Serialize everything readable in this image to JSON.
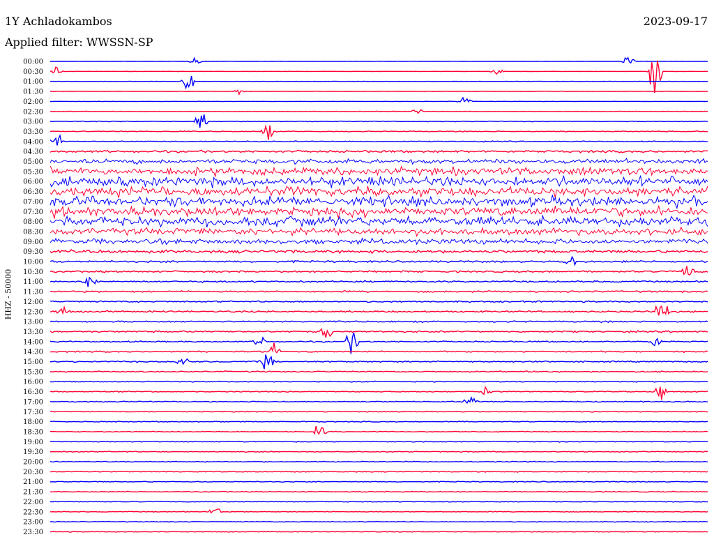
{
  "header": {
    "station": "1Y Achladokambos",
    "date": "2023-09-17",
    "filter_label": "Applied filter: WWSSN-SP"
  },
  "channel_label": "HHZ - 50000",
  "colors": {
    "even_trace": "#0000ff",
    "odd_trace": "#ff0033"
  },
  "chart_data": {
    "type": "line",
    "title": "1Y Achladokambos",
    "subtitle": "Applied filter: WWSSN-SP",
    "ylabel": "HHZ - 50000",
    "rows": [
      "00:00",
      "00:30",
      "01:00",
      "01:30",
      "02:00",
      "02:30",
      "03:00",
      "03:30",
      "04:00",
      "04:30",
      "05:00",
      "05:30",
      "06:00",
      "06:30",
      "07:00",
      "07:30",
      "08:00",
      "08:30",
      "09:00",
      "09:30",
      "10:00",
      "10:30",
      "11:00",
      "11:30",
      "12:00",
      "12:30",
      "13:00",
      "13:30",
      "14:00",
      "14:30",
      "15:00",
      "15:30",
      "16:00",
      "16:30",
      "17:00",
      "17:30",
      "18:00",
      "18:30",
      "19:00",
      "19:30",
      "20:00",
      "20:30",
      "21:00",
      "21:30",
      "22:00",
      "22:30",
      "23:00",
      "23:30"
    ],
    "activity": [
      0.15,
      0.2,
      0.2,
      0.3,
      0.2,
      0.3,
      0.5,
      0.6,
      0.7,
      1.5,
      3.5,
      6,
      7,
      7,
      7,
      7,
      7,
      5,
      4,
      2,
      1.3,
      1.2,
      1.1,
      1.1,
      1.0,
      1.1,
      1.0,
      1.1,
      0.9,
      0.9,
      0.9,
      0.8,
      0.7,
      0.7,
      0.7,
      0.6,
      0.6,
      0.6,
      0.6,
      0.6,
      0.6,
      0.6,
      0.6,
      0.6,
      0.5,
      0.5,
      0.5,
      0.5
    ],
    "events": [
      {
        "row": 0,
        "t": 0.22,
        "amp": 5
      },
      {
        "row": 0,
        "t": 0.88,
        "amp": 8
      },
      {
        "row": 1,
        "t": 0.01,
        "amp": 8
      },
      {
        "row": 1,
        "t": 0.68,
        "amp": 6
      },
      {
        "row": 1,
        "t": 0.92,
        "amp": 40
      },
      {
        "row": 2,
        "t": 0.21,
        "amp": 18
      },
      {
        "row": 3,
        "t": 0.29,
        "amp": 6
      },
      {
        "row": 4,
        "t": 0.63,
        "amp": 8
      },
      {
        "row": 5,
        "t": 0.56,
        "amp": 6
      },
      {
        "row": 6,
        "t": 0.23,
        "amp": 14
      },
      {
        "row": 7,
        "t": 0.33,
        "amp": 16
      },
      {
        "row": 8,
        "t": 0.01,
        "amp": 14
      },
      {
        "row": 20,
        "t": 0.79,
        "amp": 12
      },
      {
        "row": 21,
        "t": 0.97,
        "amp": 14
      },
      {
        "row": 22,
        "t": 0.06,
        "amp": 10
      },
      {
        "row": 25,
        "t": 0.02,
        "amp": 8
      },
      {
        "row": 25,
        "t": 0.93,
        "amp": 30
      },
      {
        "row": 27,
        "t": 0.42,
        "amp": 14
      },
      {
        "row": 28,
        "t": 0.46,
        "amp": 20
      },
      {
        "row": 28,
        "t": 0.32,
        "amp": 10
      },
      {
        "row": 28,
        "t": 0.92,
        "amp": 10
      },
      {
        "row": 29,
        "t": 0.34,
        "amp": 10
      },
      {
        "row": 30,
        "t": 0.2,
        "amp": 10
      },
      {
        "row": 30,
        "t": 0.33,
        "amp": 22
      },
      {
        "row": 33,
        "t": 0.66,
        "amp": 8
      },
      {
        "row": 33,
        "t": 0.93,
        "amp": 16
      },
      {
        "row": 34,
        "t": 0.64,
        "amp": 14
      },
      {
        "row": 37,
        "t": 0.41,
        "amp": 12
      },
      {
        "row": 45,
        "t": 0.25,
        "amp": 10
      }
    ]
  }
}
